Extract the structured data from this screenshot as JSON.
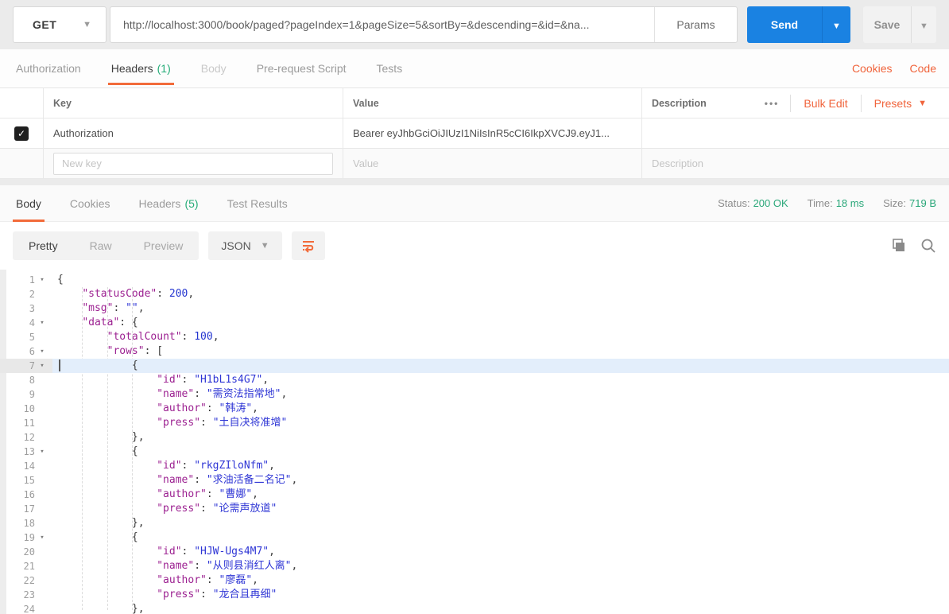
{
  "colors": {
    "accent_orange": "#f26b3a",
    "link_orange": "#f0643c",
    "green": "#26ac78",
    "send_blue": "#1a82e2",
    "json_key": "#9c2191",
    "json_value": "#2f36d5",
    "active_line_bg": "#e3eefb"
  },
  "request_bar": {
    "method": "GET",
    "url": "http://localhost:3000/book/paged?pageIndex=1&pageSize=5&sortBy=&descending=&id=&na...",
    "params_label": "Params",
    "send_label": "Send",
    "save_label": "Save"
  },
  "request_tabs": {
    "items": [
      {
        "label": "Authorization"
      },
      {
        "label": "Headers",
        "count": "(1)"
      },
      {
        "label": "Body"
      },
      {
        "label": "Pre-request Script"
      },
      {
        "label": "Tests"
      }
    ],
    "cookies_label": "Cookies",
    "code_label": "Code"
  },
  "headers_editor": {
    "columns": {
      "key": "Key",
      "value": "Value",
      "description": "Description"
    },
    "menu_dots": "•••",
    "bulk_edit_label": "Bulk Edit",
    "presets_label": "Presets",
    "rows": [
      {
        "checked": true,
        "key": "Authorization",
        "value": "Bearer eyJhbGciOiJIUzI1NiIsInR5cCI6IkpXVCJ9.eyJ1..."
      }
    ],
    "new_row": {
      "key_placeholder": "New key",
      "value_placeholder": "Value",
      "description_placeholder": "Description"
    }
  },
  "response": {
    "tabs": [
      {
        "label": "Body"
      },
      {
        "label": "Cookies"
      },
      {
        "label": "Headers",
        "count": "(5)"
      },
      {
        "label": "Test Results"
      }
    ],
    "meta": [
      {
        "label": "Status:",
        "value": "200 OK"
      },
      {
        "label": "Time:",
        "value": "18 ms"
      },
      {
        "label": "Size:",
        "value": "719 B"
      }
    ],
    "view_modes": [
      "Pretty",
      "Raw",
      "Preview"
    ],
    "active_mode": "Pretty",
    "language": "JSON"
  },
  "response_body": {
    "active_line": 7,
    "fold_lines": [
      1,
      4,
      6,
      7,
      13,
      19
    ],
    "lines": [
      {
        "num": 1,
        "tokens": [
          [
            "p",
            "{"
          ]
        ]
      },
      {
        "num": 2,
        "tokens": [
          [
            "p",
            "    "
          ],
          [
            "k",
            "\"statusCode\""
          ],
          [
            "p",
            ": "
          ],
          [
            "n",
            "200"
          ],
          [
            "p",
            ","
          ]
        ]
      },
      {
        "num": 3,
        "tokens": [
          [
            "p",
            "    "
          ],
          [
            "k",
            "\"msg\""
          ],
          [
            "p",
            ": "
          ],
          [
            "s",
            "\"\""
          ],
          [
            "p",
            ","
          ]
        ]
      },
      {
        "num": 4,
        "tokens": [
          [
            "p",
            "    "
          ],
          [
            "k",
            "\"data\""
          ],
          [
            "p",
            ": {"
          ]
        ]
      },
      {
        "num": 5,
        "tokens": [
          [
            "p",
            "        "
          ],
          [
            "k",
            "\"totalCount\""
          ],
          [
            "p",
            ": "
          ],
          [
            "n",
            "100"
          ],
          [
            "p",
            ","
          ]
        ]
      },
      {
        "num": 6,
        "tokens": [
          [
            "p",
            "        "
          ],
          [
            "k",
            "\"rows\""
          ],
          [
            "p",
            ": ["
          ]
        ]
      },
      {
        "num": 7,
        "tokens": [
          [
            "p",
            "            {"
          ]
        ]
      },
      {
        "num": 8,
        "tokens": [
          [
            "p",
            "                "
          ],
          [
            "k",
            "\"id\""
          ],
          [
            "p",
            ": "
          ],
          [
            "s",
            "\"H1bL1s4G7\""
          ],
          [
            "p",
            ","
          ]
        ]
      },
      {
        "num": 9,
        "tokens": [
          [
            "p",
            "                "
          ],
          [
            "k",
            "\"name\""
          ],
          [
            "p",
            ": "
          ],
          [
            "s",
            "\"需资法指常地\""
          ],
          [
            "p",
            ","
          ]
        ]
      },
      {
        "num": 10,
        "tokens": [
          [
            "p",
            "                "
          ],
          [
            "k",
            "\"author\""
          ],
          [
            "p",
            ": "
          ],
          [
            "s",
            "\"韩涛\""
          ],
          [
            "p",
            ","
          ]
        ]
      },
      {
        "num": 11,
        "tokens": [
          [
            "p",
            "                "
          ],
          [
            "k",
            "\"press\""
          ],
          [
            "p",
            ": "
          ],
          [
            "s",
            "\"土自决将准增\""
          ]
        ]
      },
      {
        "num": 12,
        "tokens": [
          [
            "p",
            "            },"
          ]
        ]
      },
      {
        "num": 13,
        "tokens": [
          [
            "p",
            "            {"
          ]
        ]
      },
      {
        "num": 14,
        "tokens": [
          [
            "p",
            "                "
          ],
          [
            "k",
            "\"id\""
          ],
          [
            "p",
            ": "
          ],
          [
            "s",
            "\"rkgZIloNfm\""
          ],
          [
            "p",
            ","
          ]
        ]
      },
      {
        "num": 15,
        "tokens": [
          [
            "p",
            "                "
          ],
          [
            "k",
            "\"name\""
          ],
          [
            "p",
            ": "
          ],
          [
            "s",
            "\"求油活备二名记\""
          ],
          [
            "p",
            ","
          ]
        ]
      },
      {
        "num": 16,
        "tokens": [
          [
            "p",
            "                "
          ],
          [
            "k",
            "\"author\""
          ],
          [
            "p",
            ": "
          ],
          [
            "s",
            "\"曹娜\""
          ],
          [
            "p",
            ","
          ]
        ]
      },
      {
        "num": 17,
        "tokens": [
          [
            "p",
            "                "
          ],
          [
            "k",
            "\"press\""
          ],
          [
            "p",
            ": "
          ],
          [
            "s",
            "\"论需声放道\""
          ]
        ]
      },
      {
        "num": 18,
        "tokens": [
          [
            "p",
            "            },"
          ]
        ]
      },
      {
        "num": 19,
        "tokens": [
          [
            "p",
            "            {"
          ]
        ]
      },
      {
        "num": 20,
        "tokens": [
          [
            "p",
            "                "
          ],
          [
            "k",
            "\"id\""
          ],
          [
            "p",
            ": "
          ],
          [
            "s",
            "\"HJW-Ugs4M7\""
          ],
          [
            "p",
            ","
          ]
        ]
      },
      {
        "num": 21,
        "tokens": [
          [
            "p",
            "                "
          ],
          [
            "k",
            "\"name\""
          ],
          [
            "p",
            ": "
          ],
          [
            "s",
            "\"从则县消红人离\""
          ],
          [
            "p",
            ","
          ]
        ]
      },
      {
        "num": 22,
        "tokens": [
          [
            "p",
            "                "
          ],
          [
            "k",
            "\"author\""
          ],
          [
            "p",
            ": "
          ],
          [
            "s",
            "\"廖磊\""
          ],
          [
            "p",
            ","
          ]
        ]
      },
      {
        "num": 23,
        "tokens": [
          [
            "p",
            "                "
          ],
          [
            "k",
            "\"press\""
          ],
          [
            "p",
            ": "
          ],
          [
            "s",
            "\"龙合且再细\""
          ]
        ]
      },
      {
        "num": 24,
        "tokens": [
          [
            "p",
            "            },"
          ]
        ]
      }
    ]
  }
}
